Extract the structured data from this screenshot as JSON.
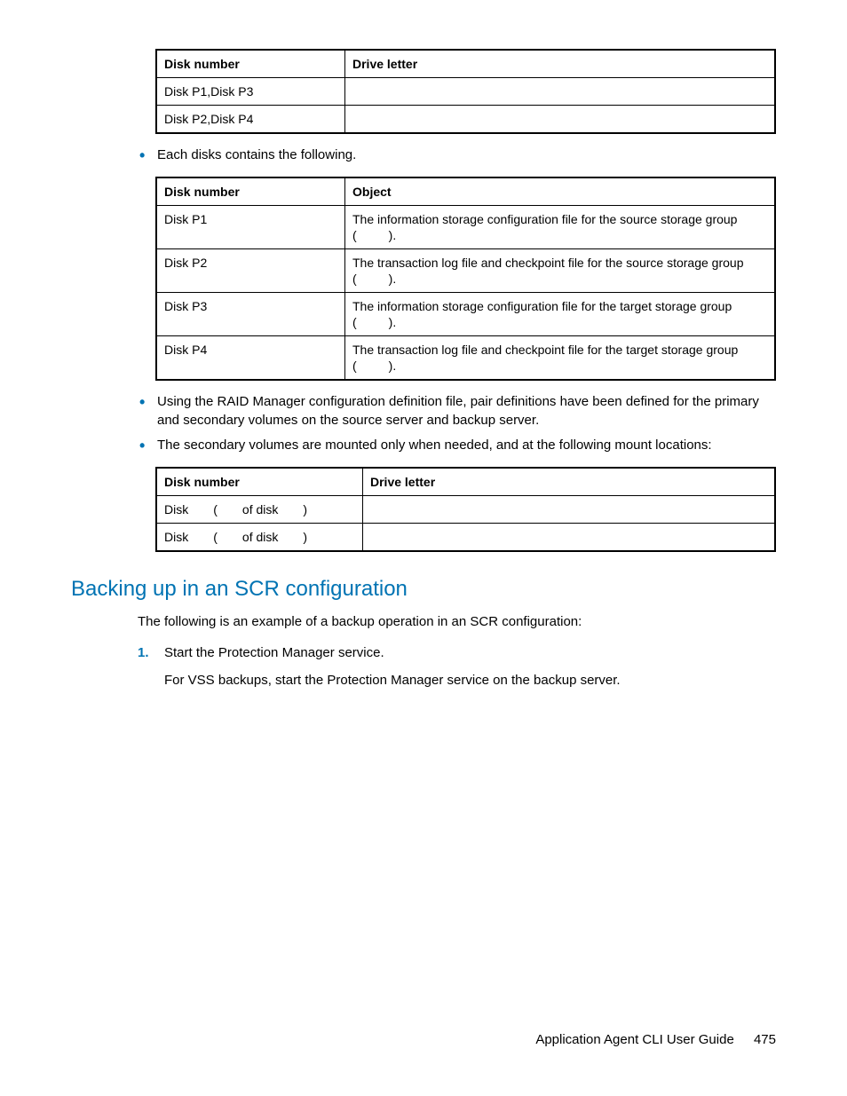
{
  "table1": {
    "headers": [
      "Disk number",
      "Drive letter"
    ],
    "rows": [
      [
        "Disk P1,Disk P3",
        ""
      ],
      [
        "Disk P2,Disk P4",
        ""
      ]
    ]
  },
  "bullet1": "Each disks contains the following.",
  "table2": {
    "headers": [
      "Disk number",
      "Object"
    ],
    "rows": [
      {
        "disk": "Disk P1",
        "l1": "The information storage configuration file for the source storage group",
        "l2a": "(",
        "l2b": ")."
      },
      {
        "disk": "Disk P2",
        "l1": "The transaction log file and checkpoint file for the source storage group",
        "l2a": "(",
        "l2b": ")."
      },
      {
        "disk": "Disk P3",
        "l1": "The information storage configuration file for the target storage group",
        "l2a": "(",
        "l2b": ")."
      },
      {
        "disk": "Disk P4",
        "l1": "The transaction log file and checkpoint file for the target storage group",
        "l2a": "(",
        "l2b": ")."
      }
    ]
  },
  "bullet2": "Using the RAID Manager configuration definition file, pair definitions have been defined for the primary and secondary volumes on the source server and backup server.",
  "bullet3": "The secondary volumes are mounted only when needed, and at the following mount locations:",
  "table3": {
    "headers": [
      "Disk number",
      "Drive letter"
    ],
    "rows": [
      {
        "pre": "Disk",
        "mid": "of disk",
        "open": "(",
        "close": ")"
      },
      {
        "pre": "Disk",
        "mid": "of disk",
        "open": "(",
        "close": ")"
      }
    ]
  },
  "heading": "Backing up in an SCR configuration",
  "intro": "The following is an example of a backup operation in an SCR configuration:",
  "step1_num": "1.",
  "step1_main": "Start the Protection Manager service.",
  "step1_sub": "For VSS backups, start the Protection Manager service on the backup server.",
  "footer_title": "Application Agent CLI User Guide",
  "footer_page": "475"
}
